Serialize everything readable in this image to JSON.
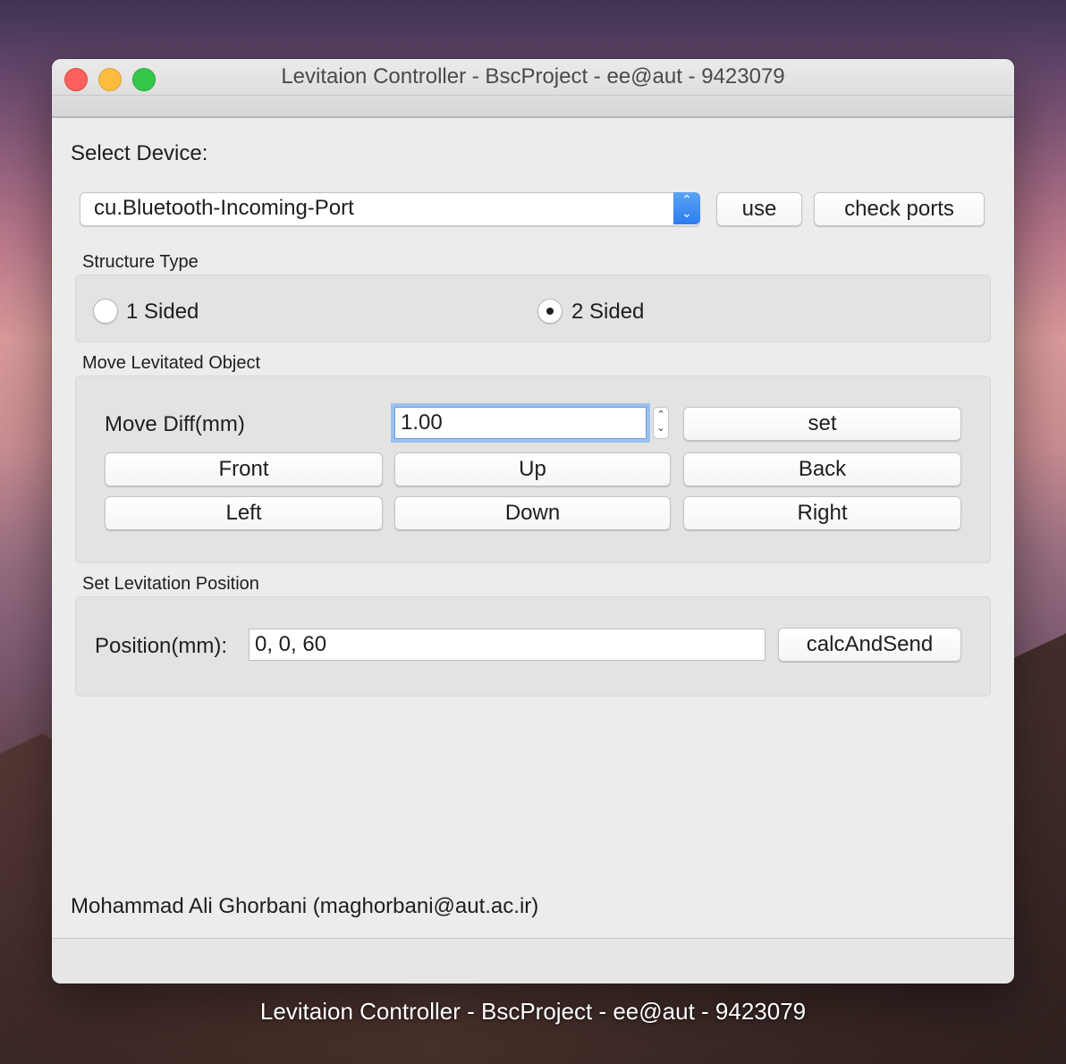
{
  "window": {
    "title": "Levitaion Controller - BscProject - ee@aut - 9423079"
  },
  "device": {
    "label": "Select Device:",
    "selected_port": "cu.Bluetooth-Incoming-Port",
    "use_button": "use",
    "check_ports_button": "check ports"
  },
  "structure_type": {
    "title": "Structure Type",
    "options": [
      {
        "label": "1 Sided",
        "selected": false
      },
      {
        "label": "2 Sided",
        "selected": true
      }
    ]
  },
  "move_object": {
    "title": "Move Levitated Object",
    "diff_label": "Move Diff(mm)",
    "diff_value": "1.00",
    "set_button": "set",
    "buttons": {
      "front": "Front",
      "up": "Up",
      "back": "Back",
      "left": "Left",
      "down": "Down",
      "right": "Right"
    }
  },
  "levitation_position": {
    "title": "Set Levitation Position",
    "position_label": "Position(mm):",
    "position_value": "0, 0, 60",
    "calc_button": "calcAndSend"
  },
  "author": "Mohammad Ali Ghorbani (maghorbani@aut.ac.ir)",
  "dock_label": "Levitaion Controller - BscProject - ee@aut - 9423079",
  "colors": {
    "accent": "#2d7cf0",
    "focus_ring": "#9cc0f0",
    "window_bg": "#ececec"
  }
}
